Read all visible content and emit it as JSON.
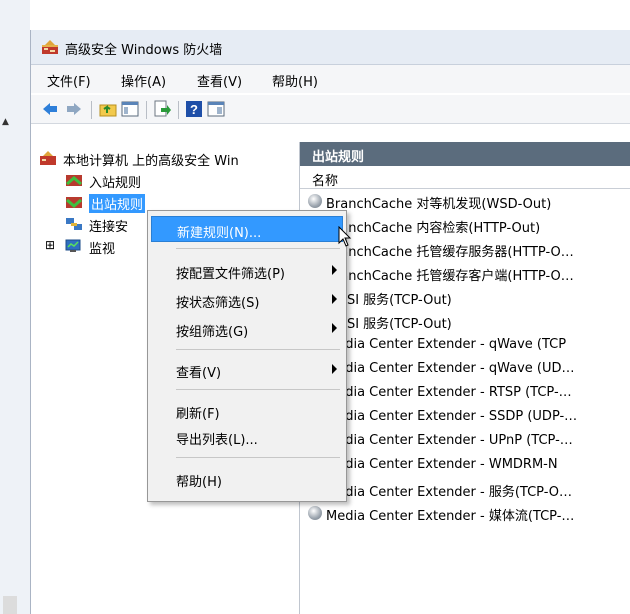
{
  "window": {
    "title": "高级安全 Windows 防火墙"
  },
  "menubar": [
    {
      "label": "文件(F)"
    },
    {
      "label": "操作(A)"
    },
    {
      "label": "查看(V)"
    },
    {
      "label": "帮助(H)"
    }
  ],
  "toolbar": {
    "icons": [
      "back-arrow-icon",
      "forward-arrow-icon",
      "up-folder-icon",
      "show-hide-tree-icon",
      "export-list-icon",
      "help-icon",
      "properties-icon"
    ]
  },
  "tree": {
    "root": "本地计算机 上的高级安全 Win",
    "items": [
      {
        "label": "入站规则"
      },
      {
        "label": "出站规则"
      },
      {
        "label": "连接安"
      },
      {
        "label": "监视"
      }
    ],
    "expander": "⊞"
  },
  "right": {
    "header": "出站规则",
    "column": "名称",
    "rows": [
      "BranchCache 对等机发现(WSD-Out)",
      "BranchCache 内容检索(HTTP-Out)",
      "BranchCache 托管缓存服务器(HTTP-O…",
      "BranchCache 托管缓存客户端(HTTP-O…",
      "iSCSI 服务(TCP-Out)",
      "iSCSI 服务(TCP-Out)",
      "Media Center Extender - qWave (TCP",
      "Media Center Extender - qWave (UD…",
      "Media Center Extender - RTSP (TCP-…",
      "Media Center Extender - SSDP (UDP-…",
      "Media Center Extender - UPnP (TCP-…",
      "Media Center Extender - WMDRM-N",
      "Media Center Extender - 服务(TCP-O…",
      "Media Center Extender - 媒体流(TCP-…"
    ]
  },
  "context_menu": {
    "new_rule": "新建规则(N)...",
    "filter_profile": "按配置文件筛选(P)",
    "filter_state": "按状态筛选(S)",
    "filter_group": "按组筛选(G)",
    "view": "查看(V)",
    "refresh": "刷新(F)",
    "export": "导出列表(L)...",
    "help": "帮助(H)"
  },
  "colors": {
    "highlight": "#3399ff",
    "pane_header": "#5b6c7d"
  }
}
